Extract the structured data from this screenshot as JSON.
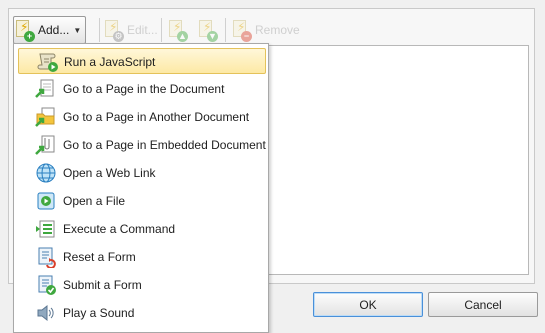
{
  "toolbar": {
    "add_label": "Add...",
    "edit_label": "Edit...",
    "remove_label": "Remove"
  },
  "menu": {
    "items": [
      {
        "label": "Run a JavaScript",
        "icon": "script-icon"
      },
      {
        "label": "Go to a Page in the Document",
        "icon": "goto-page-icon"
      },
      {
        "label": "Go to a Page in Another Document",
        "icon": "goto-other-document-icon"
      },
      {
        "label": "Go to a Page in Embedded Document",
        "icon": "goto-embedded-document-icon"
      },
      {
        "label": "Open a Web Link",
        "icon": "web-link-icon"
      },
      {
        "label": "Open a File",
        "icon": "open-file-icon"
      },
      {
        "label": "Execute a Command",
        "icon": "execute-command-icon"
      },
      {
        "label": "Reset a Form",
        "icon": "reset-form-icon"
      },
      {
        "label": "Submit a Form",
        "icon": "submit-form-icon"
      },
      {
        "label": "Play a Sound",
        "icon": "sound-icon"
      }
    ],
    "highlighted_index": 0
  },
  "buttons": {
    "ok_label": "OK",
    "cancel_label": "Cancel"
  },
  "colors": {
    "highlight": "#fde9a5",
    "default_button_border": "#4a90d9"
  }
}
